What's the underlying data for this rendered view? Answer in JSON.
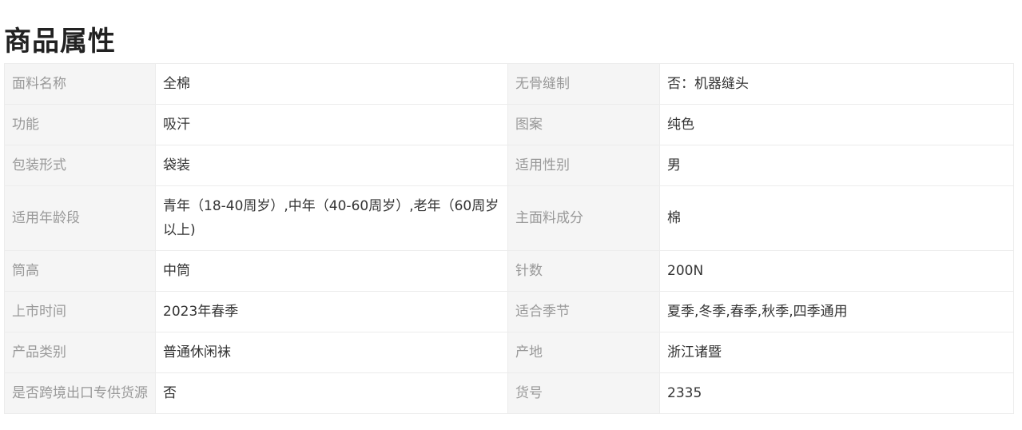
{
  "page_title": "商品属性",
  "attributes": [
    {
      "k1": "面料名称",
      "v1": "全棉",
      "k2": "无骨缝制",
      "v2": "否：机器缝头"
    },
    {
      "k1": "功能",
      "v1": "吸汗",
      "k2": "图案",
      "v2": "纯色"
    },
    {
      "k1": "包装形式",
      "v1": "袋装",
      "k2": "适用性别",
      "v2": "男"
    },
    {
      "k1": "适用年龄段",
      "v1": "青年（18-40周岁）,中年（40-60周岁）,老年（60周岁以上)",
      "k2": "主面料成分",
      "v2": "棉"
    },
    {
      "k1": "筒高",
      "v1": "中筒",
      "k2": "针数",
      "v2": "200N"
    },
    {
      "k1": "上市时间",
      "v1": "2023年春季",
      "k2": "适合季节",
      "v2": "夏季,冬季,春季,秋季,四季通用"
    },
    {
      "k1": "产品类别",
      "v1": "普通休闲袜",
      "k2": "产地",
      "v2": "浙江诸暨"
    },
    {
      "k1": "是否跨境出口专供货源",
      "v1": "否",
      "k2": "货号",
      "v2": "2335"
    }
  ]
}
